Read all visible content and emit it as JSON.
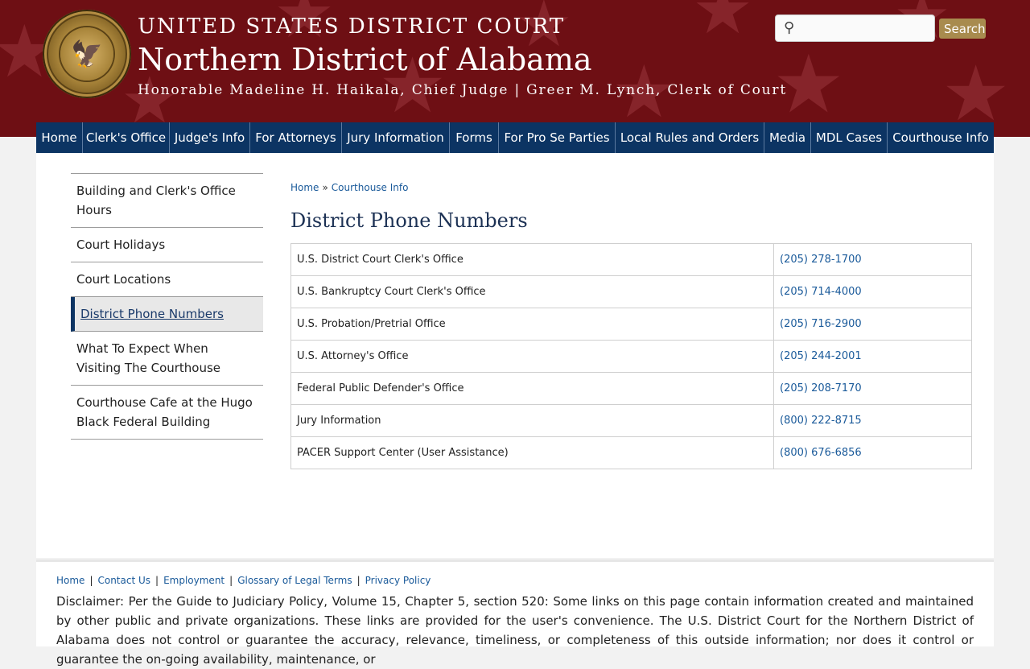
{
  "header": {
    "court_title": "UNITED STATES DISTRICT COURT",
    "district_title": "Northern District of Alabama",
    "officials_line": "Honorable Madeline H. Haikala, Chief Judge | Greer M. Lynch, Clerk of Court",
    "seal_icon": "court-seal",
    "colors": {
      "banner": "#6e0f14",
      "star": "#86242a"
    }
  },
  "search": {
    "placeholder": "",
    "value": "",
    "button_label": "Search",
    "icon": "search-icon"
  },
  "nav": {
    "items": [
      {
        "label": "Home"
      },
      {
        "label": "Clerk's Office"
      },
      {
        "label": "Judge's Info"
      },
      {
        "label": "For Attorneys"
      },
      {
        "label": "Jury Information"
      },
      {
        "label": "Forms"
      },
      {
        "label": "For Pro Se Parties"
      },
      {
        "label": "Local Rules and Orders"
      },
      {
        "label": "Media"
      },
      {
        "label": "MDL Cases"
      },
      {
        "label": "Courthouse Info"
      }
    ],
    "color": "#0c3463"
  },
  "sidebar": {
    "items": [
      {
        "label": "Building and Clerk's Office Hours"
      },
      {
        "label": "Court Holidays"
      },
      {
        "label": "Court Locations"
      },
      {
        "label": "District Phone Numbers",
        "active": true
      },
      {
        "label": "What To Expect When Visiting The Courthouse"
      },
      {
        "label": "Courthouse Cafe at the Hugo Black Federal Building"
      }
    ]
  },
  "breadcrumb": {
    "home": "Home",
    "separator": "»",
    "current": "Courthouse Info"
  },
  "page_title": "District Phone Numbers",
  "phone_table": {
    "rows": [
      {
        "name": "U.S. District Court Clerk's Office",
        "phone": "(205) 278-1700"
      },
      {
        "name": "U.S. Bankruptcy Court Clerk's Office",
        "phone": "(205) 714-4000"
      },
      {
        "name": "U.S. Probation/Pretrial Office",
        "phone": "(205) 716-2900"
      },
      {
        "name": "U.S. Attorney's Office",
        "phone": "(205) 244-2001"
      },
      {
        "name": "Federal Public Defender's Office",
        "phone": "(205) 208-7170"
      },
      {
        "name": "Jury Information",
        "phone": "(800) 222-8715"
      },
      {
        "name": "PACER Support Center (User Assistance)",
        "phone": "(800) 676-6856"
      }
    ]
  },
  "footer": {
    "links": [
      {
        "label": "Home"
      },
      {
        "label": "Contact Us"
      },
      {
        "label": "Employment"
      },
      {
        "label": "Glossary of Legal Terms"
      },
      {
        "label": "Privacy Policy"
      }
    ],
    "disclaimer": "Disclaimer: Per the Guide to Judiciary Policy, Volume 15, Chapter 5, section 520: Some links on this page contain information created and maintained by other public and private organizations. These links are provided for the user's convenience. The U.S. District Court for the Northern District of Alabama does not control or guarantee the accuracy, relevance, timeliness, or completeness of this outside information; nor does it control or guarantee the on-going availability, maintenance, or"
  }
}
